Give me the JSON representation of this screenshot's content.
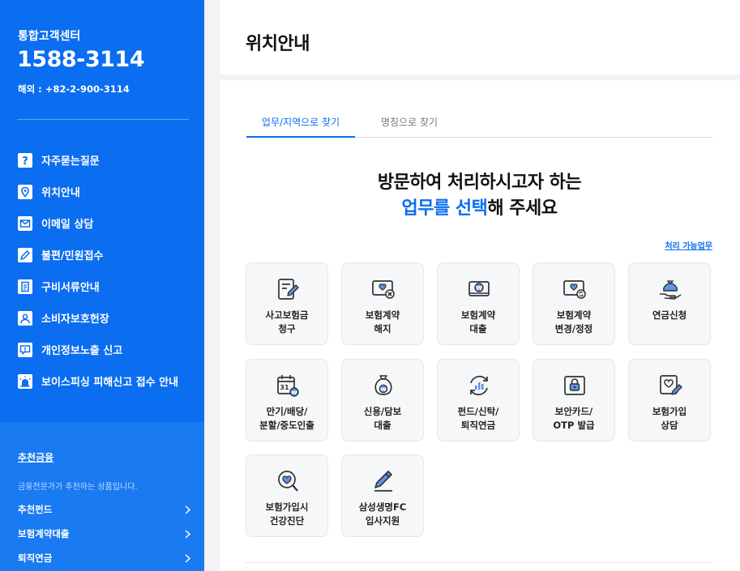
{
  "sidebar": {
    "contact_center_label": "통합고객센터",
    "phone": "1588-3114",
    "overseas": "해외 : +82-2-900-3114",
    "menu": [
      {
        "label": "자주묻는질문",
        "icon": "question-icon"
      },
      {
        "label": "위치안내",
        "icon": "location-pin-icon"
      },
      {
        "label": "이메일 상담",
        "icon": "mail-icon"
      },
      {
        "label": "불편/민원접수",
        "icon": "pencil-icon"
      },
      {
        "label": "구비서류안내",
        "icon": "document-icon"
      },
      {
        "label": "소비자보호헌장",
        "icon": "person-icon"
      },
      {
        "label": "개인정보노출 신고",
        "icon": "speech-alert-icon"
      },
      {
        "label": "보이스피싱 피해신고 접수 안내",
        "icon": "siren-icon"
      }
    ],
    "recommend": {
      "title": "추천금융",
      "description": "금융전문가가 추천하는 상품입니다.",
      "links": [
        "추천펀드",
        "보험계약대출",
        "퇴직연금"
      ]
    }
  },
  "main": {
    "page_title": "위치안내",
    "tabs": [
      {
        "label": "업무/지역으로 찾기",
        "active": true
      },
      {
        "label": "명칭으로 찾기",
        "active": false
      }
    ],
    "headline_line1": "방문하여 처리하시고자 하는",
    "headline_line2_highlight": "업무를 선택",
    "headline_line2_rest": "해 주세요",
    "available_link": "처리 가능업무",
    "services": [
      {
        "label": "사고보험금\n청구",
        "icon": "claim-form-icon"
      },
      {
        "label": "보험계약\n해지",
        "icon": "contract-cancel-icon"
      },
      {
        "label": "보험계약\n대출",
        "icon": "contract-loan-icon"
      },
      {
        "label": "보험계약\n변경/정정",
        "icon": "contract-change-icon"
      },
      {
        "label": "연금신청",
        "icon": "money-bag-hand-icon"
      },
      {
        "label": "만기/배당/\n분할/중도인출",
        "icon": "calendar-coin-icon"
      },
      {
        "label": "신용/담보\n대출",
        "icon": "money-bag-icon"
      },
      {
        "label": "펀드/신탁/\n퇴직연금",
        "icon": "fund-chart-icon"
      },
      {
        "label": "보안카드/\nOTP 발급",
        "icon": "security-lock-icon"
      },
      {
        "label": "보험가입\n상담",
        "icon": "heart-pen-icon"
      },
      {
        "label": "보험가입시\n건강진단",
        "icon": "health-check-icon"
      },
      {
        "label": "삼성생명FC\n입사지원",
        "icon": "pen-write-icon"
      }
    ]
  },
  "colors": {
    "primary": "#0b6df0",
    "sidebar_bottom": "#1a7af2",
    "card_bg": "#f6f7f9"
  }
}
